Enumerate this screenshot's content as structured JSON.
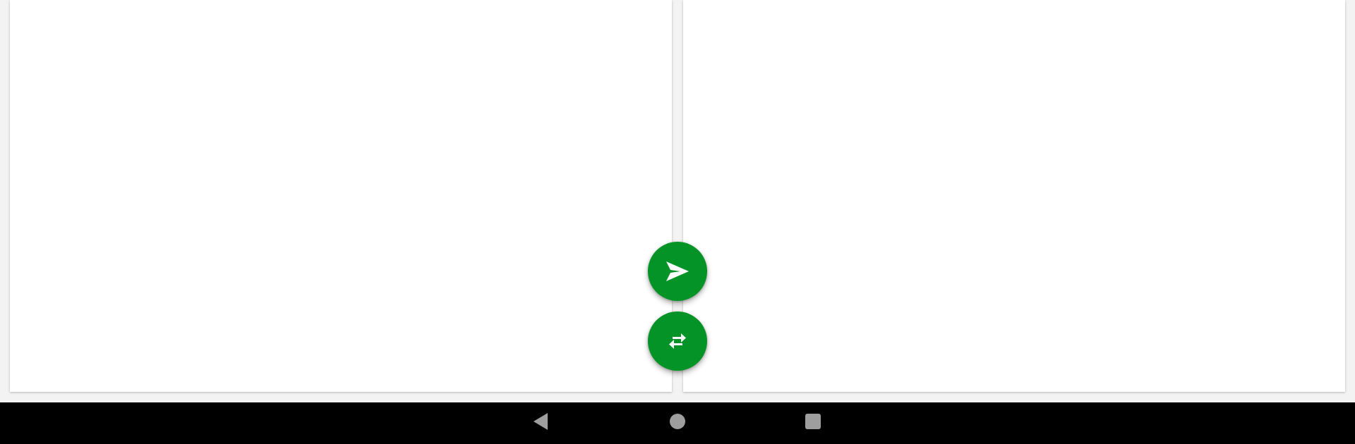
{
  "colors": {
    "fab_green": "#039326",
    "fab_icon": "#ffffff",
    "nav_background": "#000000",
    "nav_icon": "#9e9e9e",
    "panel_background": "#ffffff",
    "app_background": "#f3f3f3"
  },
  "fabs": {
    "send": {
      "icon": "send-icon"
    },
    "swap": {
      "icon": "swap-arrows-icon"
    }
  },
  "system_nav": {
    "back": {
      "icon": "back-triangle-icon"
    },
    "home": {
      "icon": "home-circle-icon"
    },
    "recents": {
      "icon": "recents-square-icon"
    }
  }
}
